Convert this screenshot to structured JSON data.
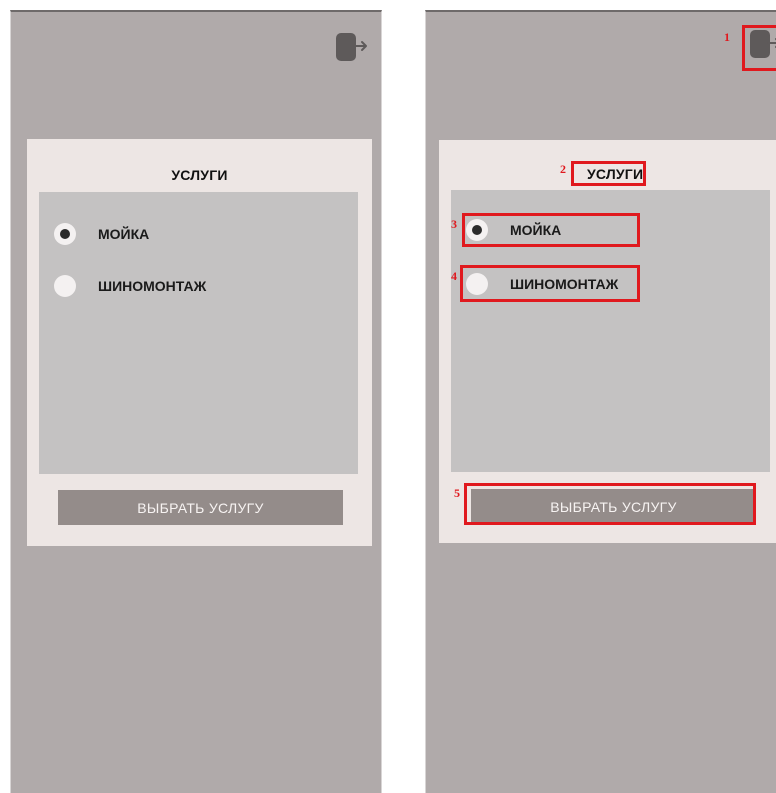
{
  "screens": [
    {
      "exit_icon": "logout-icon",
      "title": "УСЛУГИ",
      "options": [
        {
          "label": "МОЙКА",
          "selected": true
        },
        {
          "label": "ШИНОМОНТАЖ",
          "selected": false
        }
      ],
      "button_label": "ВЫБРАТЬ УСЛУГУ"
    },
    {
      "exit_icon": "logout-icon",
      "title": "УСЛУГИ",
      "options": [
        {
          "label": "МОЙКА",
          "selected": true
        },
        {
          "label": "ШИНОМОНТАЖ",
          "selected": false
        }
      ],
      "button_label": "ВЫБРАТЬ УСЛУГУ",
      "markers": [
        "1",
        "2",
        "3",
        "4",
        "5"
      ]
    }
  ],
  "colors": {
    "screen_bg": "#b0aaaa",
    "card_bg": "#ede6e4",
    "list_bg": "#c4c2c2",
    "button_bg": "#948c8a",
    "highlight": "#e0191e"
  }
}
